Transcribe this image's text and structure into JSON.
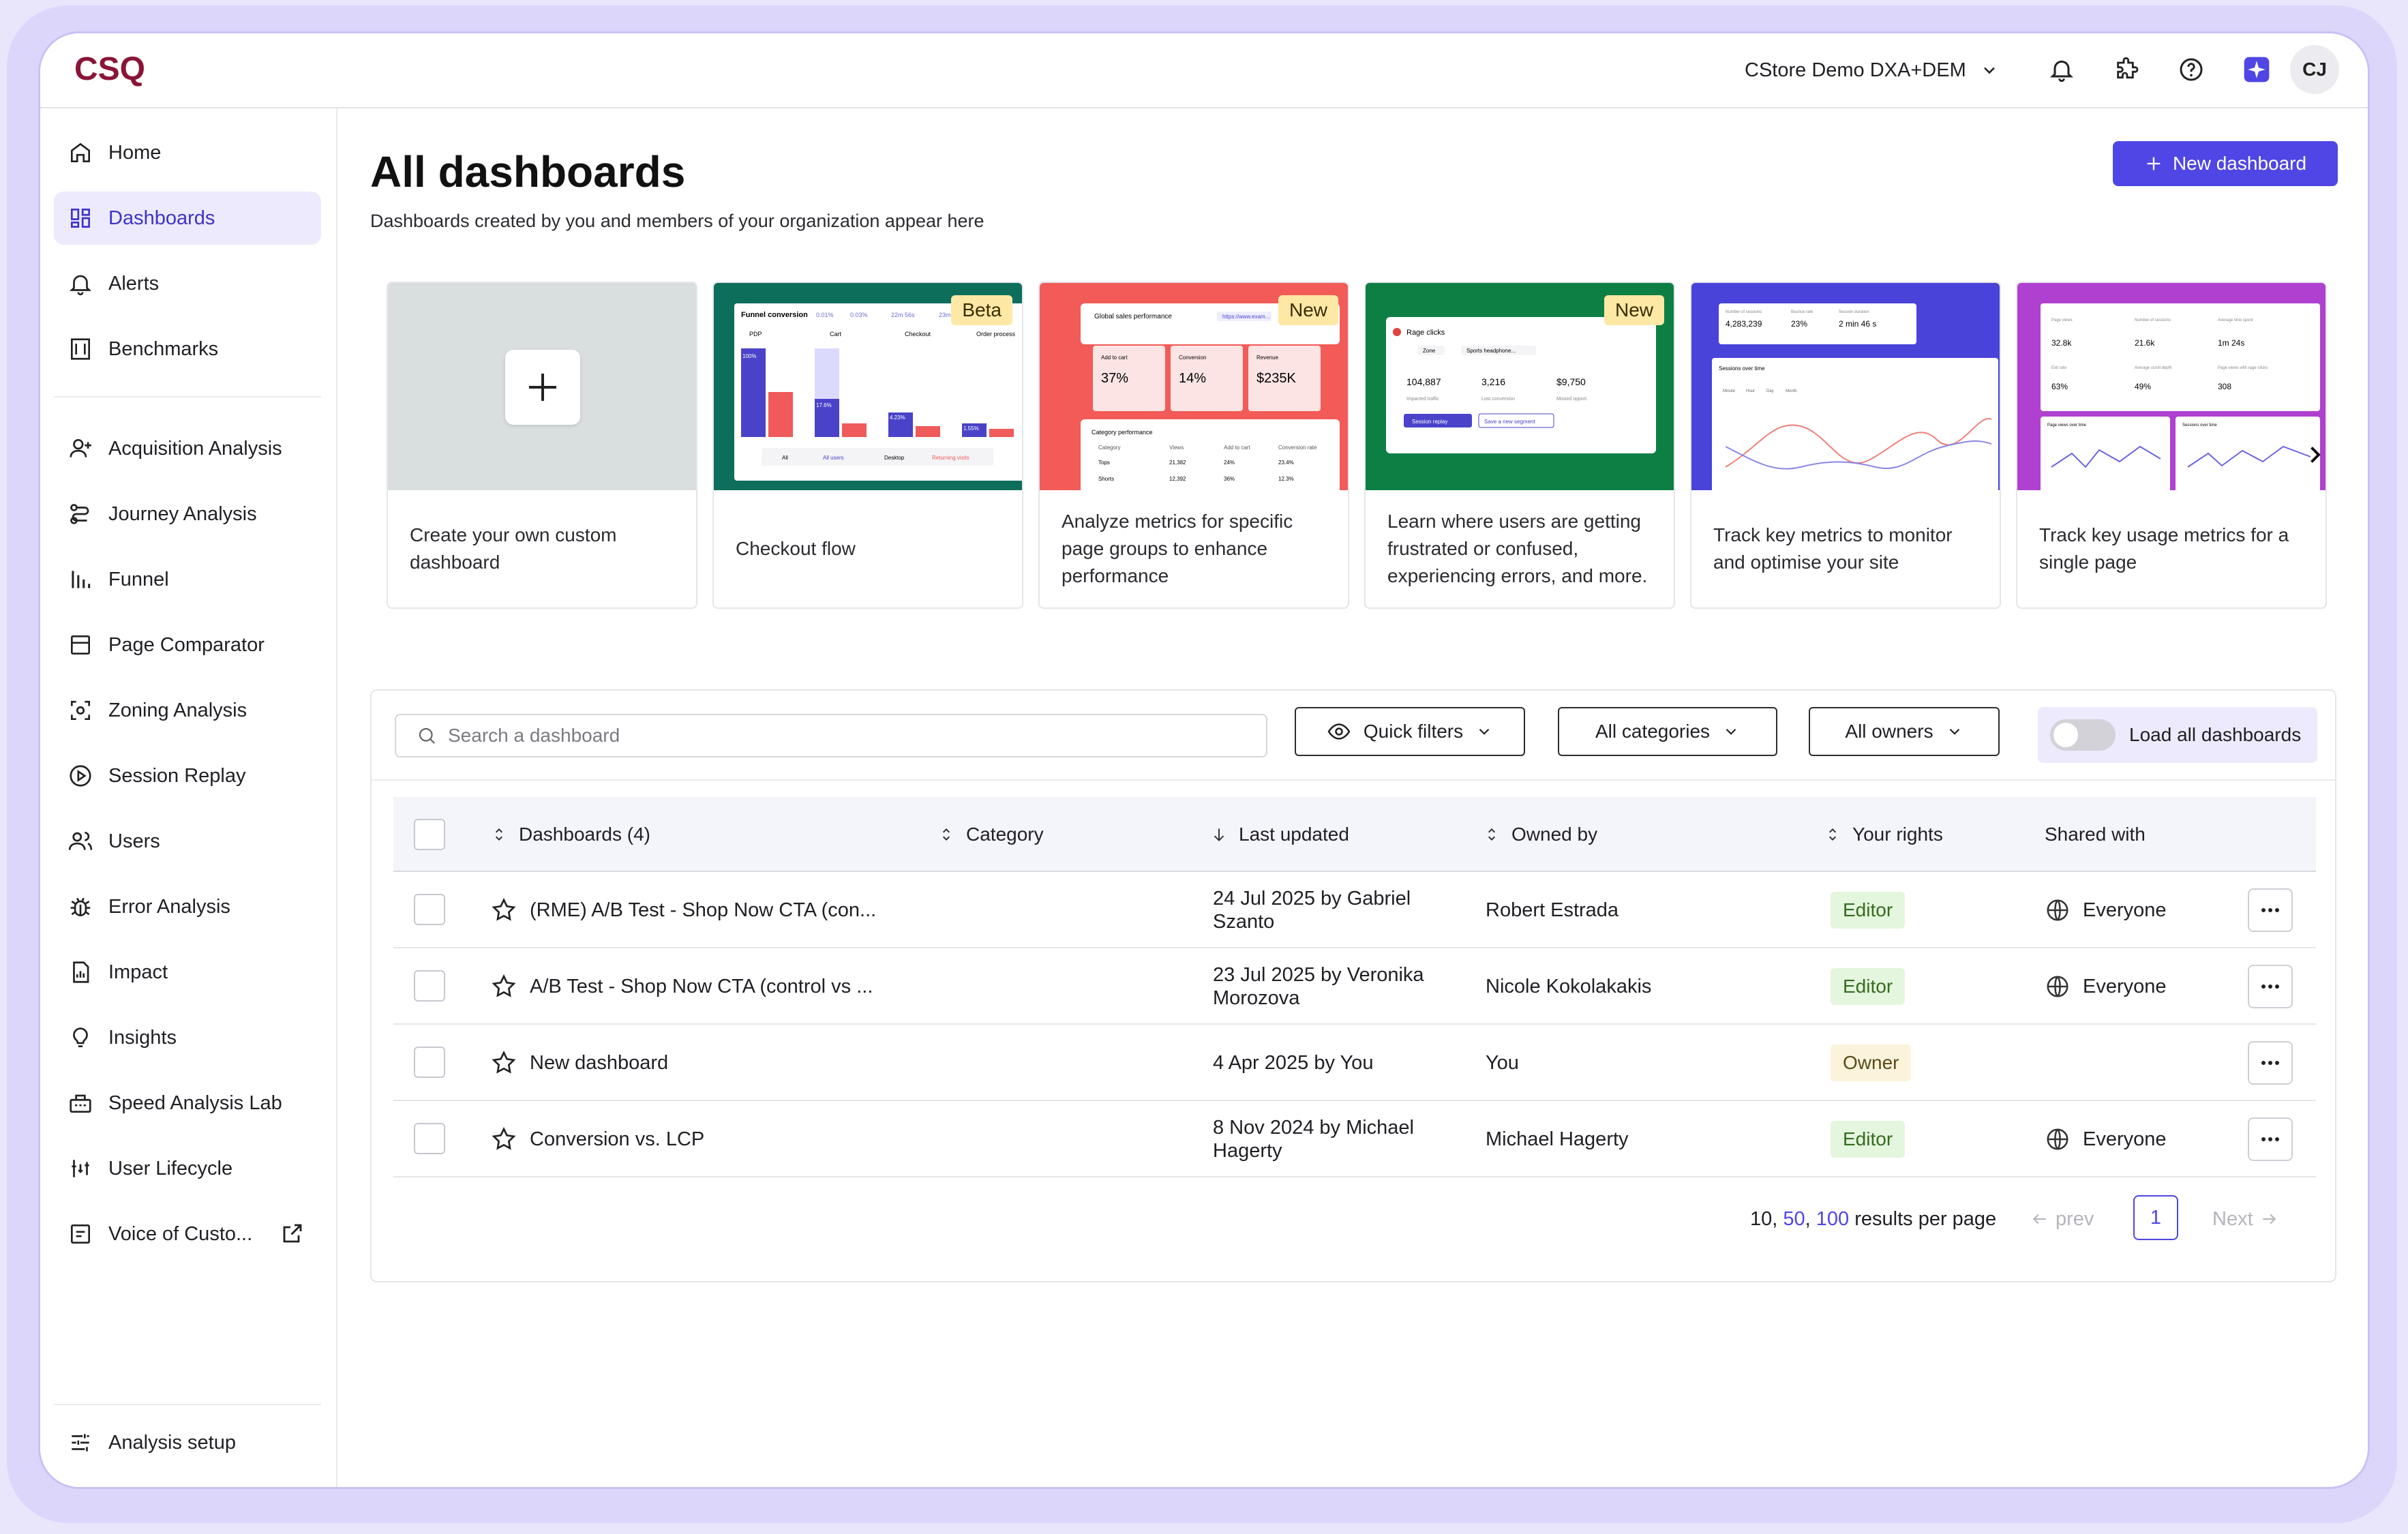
{
  "header": {
    "logo_text": "CSQ",
    "environment": "CStore Demo DXA+DEM",
    "avatar_initials": "CJ"
  },
  "sidebar": {
    "items": [
      {
        "label": "Home",
        "icon": "home-icon"
      },
      {
        "label": "Dashboards",
        "icon": "dashboard-grid-icon",
        "active": true
      },
      {
        "label": "Alerts",
        "icon": "bell-icon"
      },
      {
        "label": "Benchmarks",
        "icon": "benchmark-icon"
      },
      {
        "label": "Acquisition Analysis",
        "icon": "user-plus-icon"
      },
      {
        "label": "Journey Analysis",
        "icon": "journey-icon"
      },
      {
        "label": "Funnel",
        "icon": "funnel-bars-icon"
      },
      {
        "label": "Page Comparator",
        "icon": "page-compare-icon"
      },
      {
        "label": "Zoning Analysis",
        "icon": "zoning-icon"
      },
      {
        "label": "Session Replay",
        "icon": "play-circle-icon"
      },
      {
        "label": "Users",
        "icon": "users-icon"
      },
      {
        "label": "Error Analysis",
        "icon": "bug-icon"
      },
      {
        "label": "Impact",
        "icon": "impact-doc-icon"
      },
      {
        "label": "Insights",
        "icon": "lightbulb-icon"
      },
      {
        "label": "Speed Analysis Lab",
        "icon": "speed-lab-icon"
      },
      {
        "label": "User Lifecycle",
        "icon": "lifecycle-icon"
      },
      {
        "label": "Voice of Custo...",
        "icon": "voice-icon"
      }
    ],
    "bottom_label": "Analysis setup"
  },
  "page": {
    "title": "All dashboards",
    "subtitle": "Dashboards created by you and members of your organization appear here",
    "new_button": "New dashboard"
  },
  "templates": [
    {
      "label": "Create your own custom dashboard",
      "badge": ""
    },
    {
      "label": "Checkout flow",
      "badge": "Beta"
    },
    {
      "label": "Analyze metrics for specific page groups to enhance performance",
      "badge": "New"
    },
    {
      "label": "Learn where users are getting frustrated or confused, experiencing errors, and more.",
      "badge": "New"
    },
    {
      "label": "Track key metrics to monitor and optimise your site",
      "badge": ""
    },
    {
      "label": "Track key usage metrics for a single page",
      "badge": ""
    }
  ],
  "thumbs": {
    "checkout": {
      "title": "Funnel conversion",
      "steps": [
        "PDP",
        "Cart",
        "Checkout",
        "Order process"
      ],
      "pcts": [
        "100%",
        "17.6%",
        "4.23%",
        "1.55%"
      ],
      "filters": [
        "All",
        "All users",
        "Desktop",
        "Returning visits"
      ],
      "stats": [
        "0.01%",
        "0.03%",
        "22m 56s",
        "23m"
      ]
    },
    "page_groups": {
      "title": "Global sales performance",
      "link": "https://www.exam...",
      "metrics": [
        {
          "label": "Add to cart",
          "value": "37%"
        },
        {
          "label": "Conversion",
          "value": "14%"
        },
        {
          "label": "Revenue",
          "value": "$235K"
        }
      ],
      "table_title": "Category performance",
      "cols": [
        "Category",
        "Views",
        "Add to cart",
        "Conversion rate"
      ],
      "rows": [
        [
          "Tops",
          "21,382",
          "24%",
          "23.4%"
        ],
        [
          "Shorts",
          "12,392",
          "36%",
          "12.3%"
        ]
      ]
    },
    "frustration": {
      "title": "Rage clicks",
      "chips": [
        "Zone",
        "Sports headphone..."
      ],
      "values": [
        "104,887",
        "3,216",
        "$9,750"
      ],
      "captions": [
        "Impacted traffic",
        "Lost conversion",
        "Missed opport."
      ],
      "buttons": [
        "Session replay",
        "Save a new segment"
      ]
    },
    "key_metrics": {
      "values": [
        "4,283,239",
        "23%",
        "2 min 46 s"
      ],
      "labels": [
        "Number of sessions",
        "Bounce rate",
        "Session duration"
      ],
      "chart_title": "Sessions over time",
      "tabs": [
        "Minute",
        "Hour",
        "Day",
        "Month"
      ]
    },
    "single_page": {
      "values": [
        "32.8k",
        "21.6k",
        "1m 24s",
        "63%",
        "49%",
        "308"
      ],
      "labels": [
        "Page views",
        "Number of sessions",
        "Average time spent",
        "Exit rate",
        "Average scroll depth",
        "Page views with rage clicks"
      ],
      "charts": [
        "Page views over time",
        "Sessions over time"
      ]
    }
  },
  "filters": {
    "search_placeholder": "Search a dashboard",
    "quick_filters": "Quick filters",
    "categories": "All categories",
    "owners": "All owners",
    "load_all": "Load all dashboards"
  },
  "table": {
    "columns": {
      "name": "Dashboards (4)",
      "category": "Category",
      "updated": "Last updated",
      "owner": "Owned by",
      "rights": "Your rights",
      "shared": "Shared with"
    },
    "rows": [
      {
        "name": "(RME) A/B Test - Shop Now CTA (con...",
        "category": "",
        "updated": "24 Jul 2025 by Gabriel Szanto",
        "owner": "Robert Estrada",
        "rights": "Editor",
        "shared": "Everyone"
      },
      {
        "name": "A/B Test - Shop Now CTA (control vs ...",
        "category": "",
        "updated": "23 Jul 2025 by Veronika Morozova",
        "owner": "Nicole Kokolakakis",
        "rights": "Editor",
        "shared": "Everyone"
      },
      {
        "name": "New dashboard",
        "category": "",
        "updated": "4 Apr 2025 by You",
        "owner": "You",
        "rights": "Owner",
        "shared": ""
      },
      {
        "name": "Conversion vs. LCP",
        "category": "",
        "updated": "8 Nov 2024 by Michael Hagerty",
        "owner": "Michael Hagerty",
        "rights": "Editor",
        "shared": "Everyone"
      }
    ]
  },
  "pagination": {
    "sizes": [
      "10",
      "50",
      "100"
    ],
    "size_suffix": "results per page",
    "prev": "prev",
    "page": "1",
    "next": "Next"
  },
  "colors": {
    "accent": "#4f46e5",
    "brand": "#8a1538",
    "editor_bg": "#e4f6dd",
    "owner_bg": "#fcf3dc"
  }
}
